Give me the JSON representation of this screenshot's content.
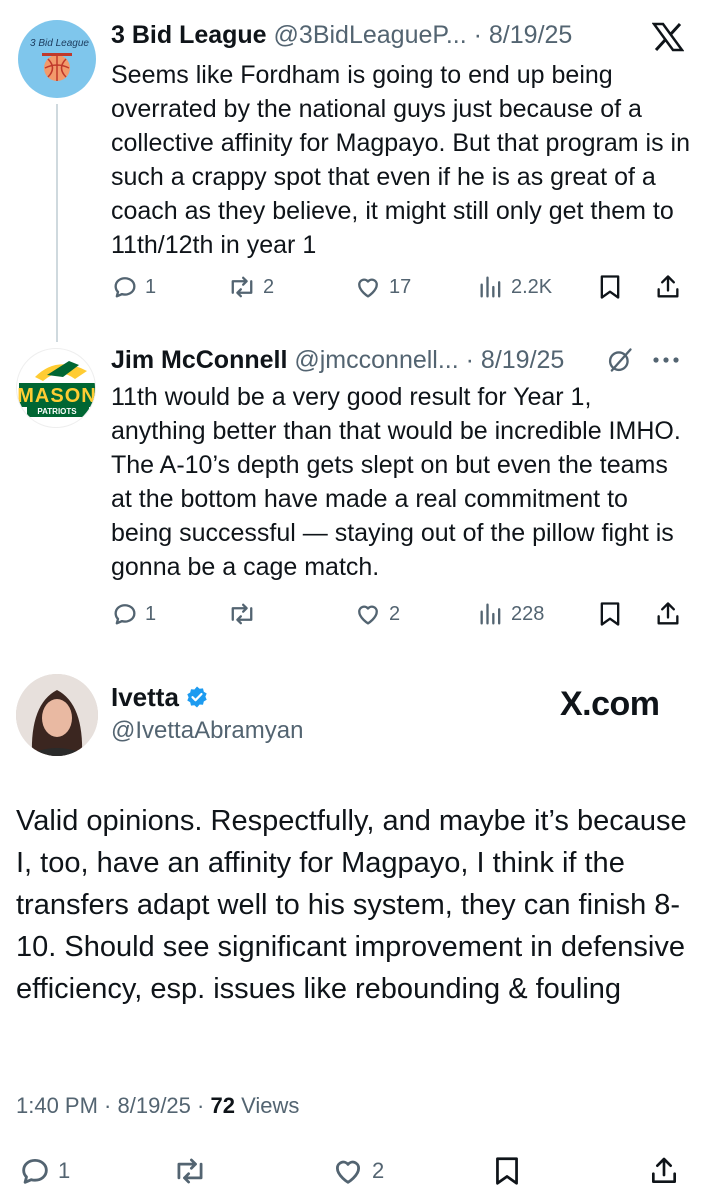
{
  "tweet1": {
    "avatar_text": "3 Bid League",
    "name": "3 Bid League",
    "handle": "@3BidLeagueP...",
    "date": "8/19/25",
    "text": "Seems like Fordham is going to end up being overrated by the national guys just because of a collective affinity for Magpayo. But that program is in such a crappy spot that even if he is as great of a coach as they believe, it might still only get them to 11th/12th in year 1",
    "replies": "1",
    "reposts": "2",
    "likes": "17",
    "views": "2.2K"
  },
  "tweet2": {
    "avatar_text_main": "MASON",
    "avatar_text_sub": "PATRIOTS",
    "name": "Jim McConnell",
    "handle": "@jmcconnell...",
    "date": "8/19/25",
    "text": "11th would be a very good result for Year 1, anything better than that would be incredible IMHO. The A-10’s depth gets slept on but even the teams at the bottom have made a real commitment to being successful — staying out of the pillow fight is gonna be a cage match.",
    "replies": "1",
    "reposts": "",
    "likes": "2",
    "views": "228"
  },
  "main_tweet": {
    "name": "Ivetta",
    "handle": "@IvettaAbramyan",
    "brand": "X.com",
    "text": "Valid opinions. Respectfully, and maybe it’s because I, too, have an affinity for Magpayo, I think if the transfers adapt well to his system, they can finish 8-10. Should see significant improvement in defensive efficiency, esp. issues like rebounding & fouling",
    "time": "1:40 PM",
    "date": "8/19/25",
    "views_count": "72",
    "views_label": "Views",
    "replies": "1",
    "reposts": "",
    "likes": "2"
  },
  "colors": {
    "text": "#0f1419",
    "muted": "#536471",
    "verified": "#1d9bf0",
    "mason_green": "#006633",
    "mason_gold": "#ffcc33"
  }
}
